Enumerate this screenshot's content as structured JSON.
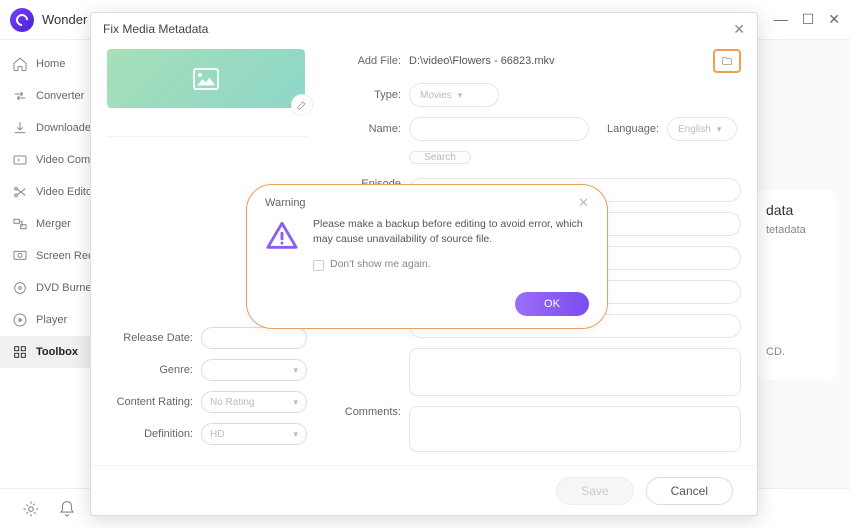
{
  "app_name": "Wonder",
  "sidebar": {
    "items": [
      {
        "label": "Home"
      },
      {
        "label": "Converter"
      },
      {
        "label": "Downloader"
      },
      {
        "label": "Video Compressor"
      },
      {
        "label": "Video Editor"
      },
      {
        "label": "Merger"
      },
      {
        "label": "Screen Recorder"
      },
      {
        "label": "DVD Burner"
      },
      {
        "label": "Player"
      },
      {
        "label": "Toolbox"
      }
    ]
  },
  "right_panel": {
    "title": "data",
    "sub": "tetadata",
    "note": "CD."
  },
  "modal": {
    "title": "Fix Media Metadata",
    "add_file_label": "Add File:",
    "add_file_value": "D:\\video\\Flowers - 66823.mkv",
    "type_label": "Type:",
    "type_value": "Movies",
    "name_label": "Name:",
    "language_label": "Language:",
    "language_value": "English",
    "search_label": "Search",
    "episode_label": "Episode Name:",
    "release_label": "Release Date:",
    "genre_label": "Genre:",
    "content_rating_label": "Content Rating:",
    "content_rating_value": "No Rating",
    "definition_label": "Definition:",
    "definition_value": "HD",
    "comments_label": "Comments:",
    "save_label": "Save",
    "cancel_label": "Cancel"
  },
  "warning": {
    "title": "Warning",
    "message": "Please make a backup before editing to avoid error, which may cause unavailability of source file.",
    "checkbox_label": "Don't show me again.",
    "ok_label": "OK"
  }
}
